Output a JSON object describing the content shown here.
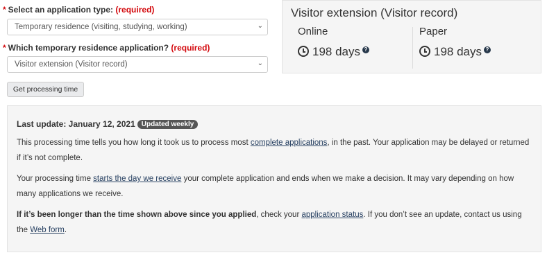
{
  "form": {
    "app_type": {
      "star": "*",
      "label": "Select an application type:",
      "required": "(required)",
      "value": "Temporary residence (visiting, studying, working)"
    },
    "residence_app": {
      "star": "*",
      "label": "Which temporary residence application?",
      "required": "(required)",
      "value": "Visitor extension (Visitor record)"
    },
    "submit_label": "Get processing time"
  },
  "result": {
    "title": "Visitor extension (Visitor record)",
    "columns": [
      {
        "heading": "Online",
        "value": "198 days",
        "help": "?"
      },
      {
        "heading": "Paper",
        "value": "198 days",
        "help": "?"
      }
    ]
  },
  "info": {
    "last_update_label": "Last update: January 12, 2021",
    "badge": "Updated weekly",
    "p1": {
      "a": "This processing time tells you how long it took us to process most ",
      "link": "complete applications",
      "b": ", in the past. Your application may be delayed or returned if it’s not complete."
    },
    "p2": {
      "a": "Your processing time ",
      "link": "starts the day we receive",
      "b": " your complete application and ends when we make a decision. It may vary depending on how many applications we receive."
    },
    "p3": {
      "bold": "If it’s been longer than the time shown above since you applied",
      "a": ", check your ",
      "link1": "application status",
      "b": ". If you don’t see an update, contact us using the ",
      "link2": "Web form",
      "c": "."
    }
  },
  "icons": {
    "clock": "clock-icon",
    "help": "question-circle-icon",
    "chevron": "chevron-down-icon"
  },
  "colors": {
    "required": "#d3080c",
    "link": "#284162",
    "panel_bg": "#f5f5f5",
    "badge_bg": "#555555"
  }
}
